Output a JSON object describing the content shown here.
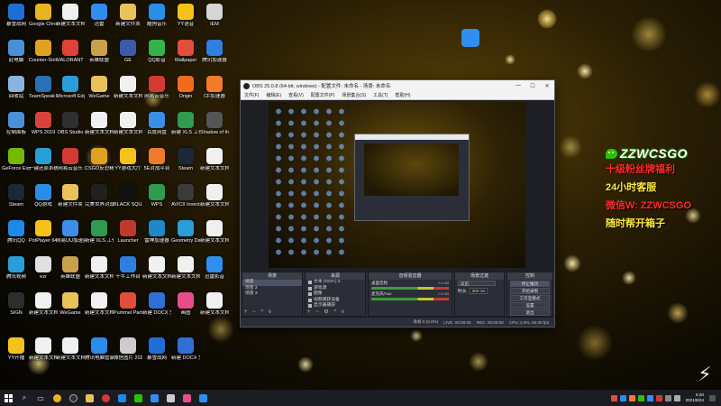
{
  "desktop_icons": [
    {
      "label": "暴雪战网",
      "color": "#1d6fd6"
    },
    {
      "label": "Google Chrome",
      "color": "#e8b422"
    },
    {
      "label": "新建文本文档",
      "color": "#f0f0f0"
    },
    {
      "label": "迅雷",
      "color": "#2f8ef0"
    },
    {
      "label": "新建文件夹",
      "color": "#e9c35a"
    },
    {
      "label": "酷狗音乐",
      "color": "#2a8ee8"
    },
    {
      "label": "YY语音",
      "color": "#f4c21b"
    },
    {
      "label": "IEM",
      "color": "#d6d6d6"
    },
    {
      "label": "此电脑",
      "color": "#4a90d9"
    },
    {
      "label": "Counter-Strike Global Off...",
      "color": "#e0a020"
    },
    {
      "label": "VALORANT",
      "color": "#e0413a"
    },
    {
      "label": "英雄联盟",
      "color": "#c9a14a"
    },
    {
      "label": "GE",
      "color": "#3a5ca8"
    },
    {
      "label": "QQ影音",
      "color": "#34b24c"
    },
    {
      "label": "Wallpaper",
      "color": "#e34d3c"
    },
    {
      "label": "腾讯加速器",
      "color": "#2f7fe0"
    },
    {
      "label": "回收站",
      "color": "#8ab4e0"
    },
    {
      "label": "TeamSpeak 3",
      "color": "#2b6fb4"
    },
    {
      "label": "Microsoft Edge",
      "color": "#2a9ed8"
    },
    {
      "label": "WeGame",
      "color": "#e9c35a"
    },
    {
      "label": "新建文本文档",
      "color": "#f0f0f0"
    },
    {
      "label": "网易云音乐",
      "color": "#d33a31"
    },
    {
      "label": "Origin",
      "color": "#f06b1e"
    },
    {
      "label": "CF加速器",
      "color": "#f07b2a"
    },
    {
      "label": "控制面板",
      "color": "#4a90d9"
    },
    {
      "label": "WPS 2019",
      "color": "#d8423a"
    },
    {
      "label": "OBS Studio",
      "color": "#2f2f2f"
    },
    {
      "label": "新建文本文档",
      "color": "#f0f0f0"
    },
    {
      "label": "新建文本文档",
      "color": "#f0f0f0"
    },
    {
      "label": "百度网盘",
      "color": "#3b8fe8"
    },
    {
      "label": "新建 XLS 工作表",
      "color": "#2e9b4f"
    },
    {
      "label": "Shadow of the Tomb Raider",
      "color": "#555555"
    },
    {
      "label": "GeForce Experience",
      "color": "#76b900"
    },
    {
      "label": "一键还原系统",
      "color": "#2a9ed8"
    },
    {
      "label": "网易云音乐",
      "color": "#d33a31"
    },
    {
      "label": "CSGO反恐精英",
      "color": "#e0a020"
    },
    {
      "label": "YY游戏大厅",
      "color": "#f4c21b"
    },
    {
      "label": "5E对战平台",
      "color": "#f07b2a"
    },
    {
      "label": "Steam",
      "color": "#1b2838"
    },
    {
      "label": "新建文本文档",
      "color": "#f0f0f0"
    },
    {
      "label": "Steam",
      "color": "#1b2838"
    },
    {
      "label": "QQ游戏",
      "color": "#2a8ee8"
    },
    {
      "label": "新建文件夹",
      "color": "#e9c35a"
    },
    {
      "label": "完美世界对战",
      "color": "#202020"
    },
    {
      "label": "BLACK SQUAD",
      "color": "#111111"
    },
    {
      "label": "WPS",
      "color": "#2e9b4f"
    },
    {
      "label": "AVICII Invector",
      "color": "#3a3a3a"
    },
    {
      "label": "新建文本文档",
      "color": "#f0f0f0"
    },
    {
      "label": "腾讯QQ",
      "color": "#1d8ae8"
    },
    {
      "label": "PotPlayer 64 bit",
      "color": "#f4c21b"
    },
    {
      "label": "网易UU加速器",
      "color": "#3b8fe8"
    },
    {
      "label": "新建 XLS 工作表",
      "color": "#2e9b4f"
    },
    {
      "label": "Launcher",
      "color": "#c0392b"
    },
    {
      "label": "雷神加速器",
      "color": "#1e88c8"
    },
    {
      "label": "Geometry Dash",
      "color": "#2a9ed8"
    },
    {
      "label": "新建文本文档",
      "color": "#f0f0f0"
    },
    {
      "label": "腾讯视频",
      "color": "#2a9ed8"
    },
    {
      "label": "ezr",
      "color": "#e0e0e0"
    },
    {
      "label": "英雄联盟",
      "color": "#c9a14a"
    },
    {
      "label": "新建文本文档",
      "color": "#f0f0f0"
    },
    {
      "label": "千牛工作台",
      "color": "#2f7fe0"
    },
    {
      "label": "新建文本文档",
      "color": "#f0f0f0"
    },
    {
      "label": "新建文本文档",
      "color": "#f0f0f0"
    },
    {
      "label": "迅雷影音",
      "color": "#2f8ef0"
    },
    {
      "label": "SIGN",
      "color": "#2d2d2d"
    },
    {
      "label": "新建文本文档",
      "color": "#f0f0f0"
    },
    {
      "label": "WeGame",
      "color": "#e9c35a"
    },
    {
      "label": "新建文本文档",
      "color": "#f0f0f0"
    },
    {
      "label": "Pummel Party",
      "color": "#e34d3c"
    },
    {
      "label": "新建 DOCX 文档",
      "color": "#2f6fd6"
    },
    {
      "label": "画图",
      "color": "#e84d8a"
    },
    {
      "label": "新建文本文档",
      "color": "#f0f0f0"
    },
    {
      "label": "YY开播",
      "color": "#f4c21b"
    },
    {
      "label": "新建文本文档",
      "color": "#f0f0f0"
    },
    {
      "label": "新建文本文档",
      "color": "#f0f0f0"
    },
    {
      "label": "腾讯电脑管家",
      "color": "#2a8ee8"
    },
    {
      "label": "微信图片 20210724...",
      "color": "#cccccc"
    },
    {
      "label": "暴雪战网",
      "color": "#1d6fd6"
    },
    {
      "label": "新建 DOCX 文档",
      "color": "#2f6fd6"
    },
    {
      "label": "",
      "color": "#000000"
    }
  ],
  "obs": {
    "title": "OBS 25.0.8 (64-bit, windows) - 配置文件: 未命名 - 场景: 未命名",
    "menu": [
      "文件(F)",
      "编辑(E)",
      "查看(V)",
      "配置文件(P)",
      "场景集合(S)",
      "工具(T)",
      "帮助(H)"
    ],
    "docks": {
      "scenes": {
        "title": "场景",
        "items": [
          "场景",
          "场景 2",
          "场景 3"
        ]
      },
      "sources": {
        "title": "来源",
        "items": [
          "文本 (GDI+) 2",
          "游戏源",
          "图像",
          "视频捕获设备",
          "显示器捕获"
        ]
      },
      "mixer": {
        "title": "音频混音器",
        "channels": [
          {
            "name": "桌面音频",
            "db": "0.0 dB"
          },
          {
            "name": "麦克风/Aux",
            "db": "0.0 dB"
          }
        ]
      },
      "transitions": {
        "title": "场景过渡",
        "selected": "淡出",
        "duration_label": "时长",
        "duration": "300 ms"
      },
      "controls": {
        "title": "控制",
        "buttons": [
          "停止推流",
          "开始录制",
          "工作室模式",
          "设置",
          "退出"
        ]
      }
    },
    "status": {
      "live": "LIVE: 00:39:05",
      "rec": "REC: 00:00:00",
      "cpu": "CPU: 2.0%, 60.00 fps",
      "dropped": "丢帧 0 (0.0%)"
    }
  },
  "promo": {
    "wechat_id": "ZZWCSGO",
    "line1": "十级粉丝牌福利",
    "line2": "24小时客服",
    "line3": "微信W: ZZWCSGO",
    "line4": "随时帮开箱子"
  },
  "taskbar": {
    "time": "6:20",
    "date": "2021/9/24"
  }
}
